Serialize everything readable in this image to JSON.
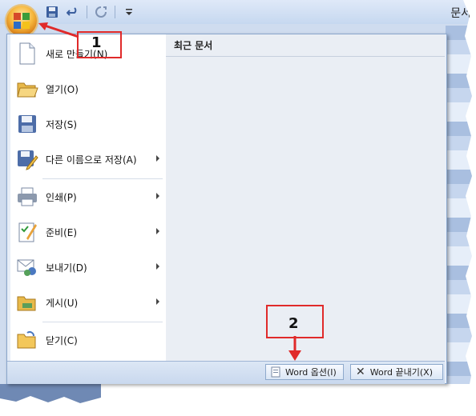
{
  "window": {
    "title_fragment": "문서"
  },
  "qat": {
    "icons": [
      "save-icon",
      "undo-icon",
      "redo-icon",
      "customize-dropdown-icon"
    ]
  },
  "menu": {
    "items": [
      {
        "label": "새로 만들기(N)",
        "icon": "new-document-icon",
        "has_submenu": false
      },
      {
        "label": "열기(O)",
        "icon": "open-folder-icon",
        "has_submenu": false
      },
      {
        "label": "저장(S)",
        "icon": "save-disk-icon",
        "has_submenu": false
      },
      {
        "label": "다른 이름으로 저장(A)",
        "icon": "save-as-icon",
        "has_submenu": true
      },
      {
        "label": "인쇄(P)",
        "icon": "printer-icon",
        "has_submenu": true
      },
      {
        "label": "준비(E)",
        "icon": "prepare-icon",
        "has_submenu": true
      },
      {
        "label": "보내기(D)",
        "icon": "send-icon",
        "has_submenu": true
      },
      {
        "label": "게시(U)",
        "icon": "publish-icon",
        "has_submenu": true
      },
      {
        "label": "닫기(C)",
        "icon": "close-folder-icon",
        "has_submenu": false
      }
    ],
    "recent_header": "최근 문서",
    "footer": {
      "options_label": "Word 옵션(I)",
      "exit_label": "Word 끝내기(X)"
    }
  },
  "annotations": {
    "step1": "1",
    "step2": "2"
  },
  "colors": {
    "annotation_red": "#e02a2a",
    "menu_bg": "#e7eef8",
    "recent_pane_bg": "#eaeef4"
  }
}
